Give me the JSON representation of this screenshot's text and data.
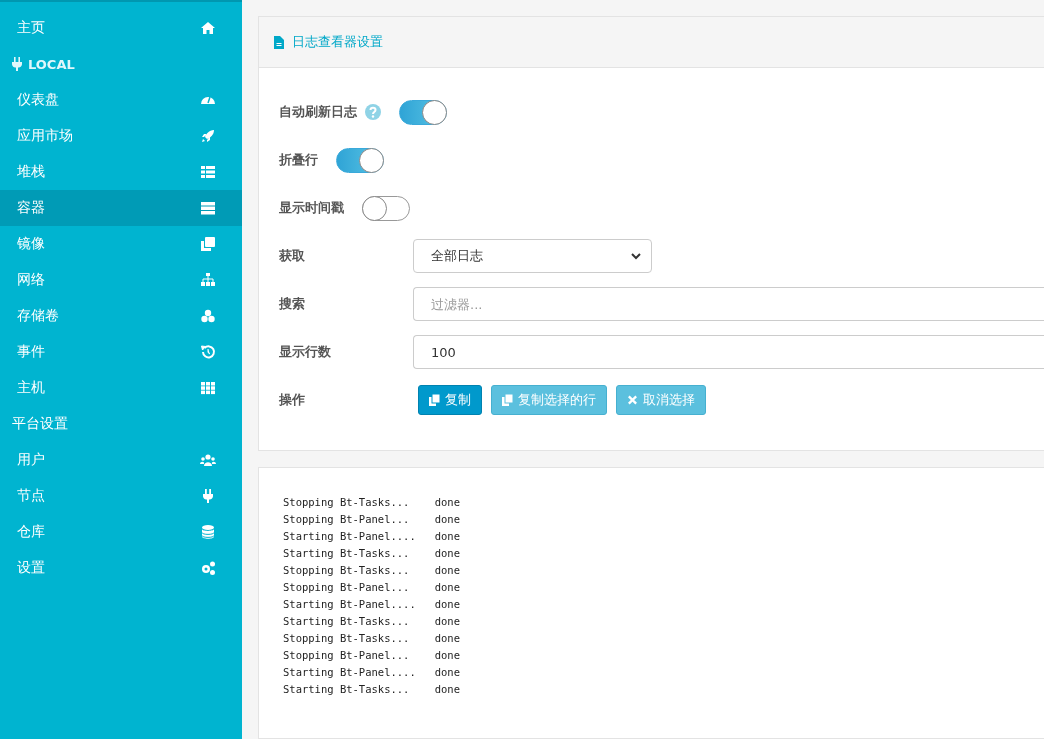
{
  "sidebar": {
    "items": [
      {
        "kind": "item",
        "label": "主页",
        "selected": false
      },
      {
        "kind": "header",
        "label": "LOCAL"
      },
      {
        "kind": "item",
        "label": "仪表盘",
        "selected": false
      },
      {
        "kind": "item",
        "label": "应用市场",
        "selected": false
      },
      {
        "kind": "item",
        "label": "堆栈",
        "selected": false
      },
      {
        "kind": "item",
        "label": "容器",
        "selected": true
      },
      {
        "kind": "item",
        "label": "镜像",
        "selected": false
      },
      {
        "kind": "item",
        "label": "网络",
        "selected": false
      },
      {
        "kind": "item",
        "label": "存储卷",
        "selected": false
      },
      {
        "kind": "item",
        "label": "事件",
        "selected": false
      },
      {
        "kind": "item",
        "label": "主机",
        "selected": false
      },
      {
        "kind": "section",
        "label": "平台设置"
      },
      {
        "kind": "item",
        "label": "用户",
        "selected": false
      },
      {
        "kind": "item",
        "label": "节点",
        "selected": false
      },
      {
        "kind": "item",
        "label": "仓库",
        "selected": false
      },
      {
        "kind": "item",
        "label": "设置",
        "selected": false
      }
    ]
  },
  "settings": {
    "title": "日志查看器设置",
    "toggles": [
      {
        "label": "自动刷新日志",
        "help": true,
        "on": true
      },
      {
        "label": "折叠行",
        "help": false,
        "on": true
      },
      {
        "label": "显示时间戳",
        "help": false,
        "on": false
      }
    ],
    "fetch": {
      "label": "获取",
      "value": "全部日志"
    },
    "search": {
      "label": "搜索",
      "placeholder": "过滤器..."
    },
    "lines": {
      "label": "显示行数",
      "value": "100"
    },
    "actions": {
      "label": "操作",
      "buttons": [
        {
          "kind": "copy",
          "label": "复制",
          "disabled": false
        },
        {
          "kind": "copy",
          "label": "复制选择的行",
          "disabled": true
        },
        {
          "kind": "clear",
          "label": "取消选择",
          "disabled": true
        }
      ]
    }
  },
  "log": {
    "lines": [
      "Stopping Bt-Tasks...    done",
      "Stopping Bt-Panel...    done",
      "Starting Bt-Panel....   done",
      "Starting Bt-Tasks...    done",
      "Stopping Bt-Tasks...    done",
      "Stopping Bt-Panel...    done",
      "Starting Bt-Panel....   done",
      "Starting Bt-Tasks...    done",
      "Stopping Bt-Tasks...    done",
      "Stopping Bt-Panel...    done",
      "Starting Bt-Panel....   done",
      "Starting Bt-Tasks...    done"
    ]
  }
}
